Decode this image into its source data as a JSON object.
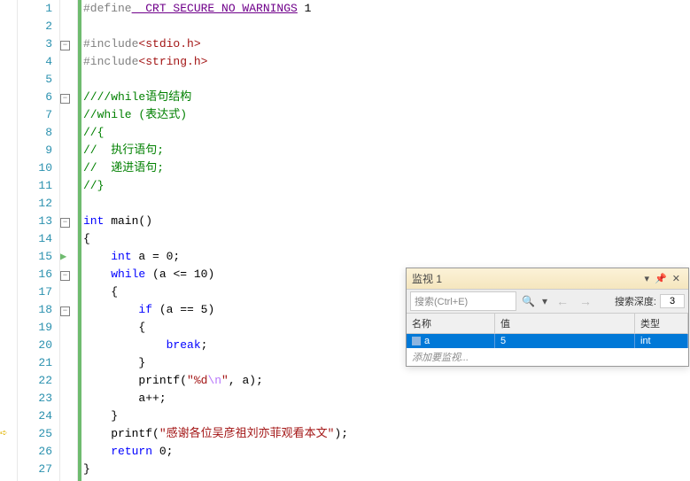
{
  "lines": {
    "1": {
      "n": "1"
    },
    "2": {
      "n": "2"
    },
    "3": {
      "n": "3"
    },
    "4": {
      "n": "4"
    },
    "5": {
      "n": "5"
    },
    "6": {
      "n": "6"
    },
    "7": {
      "n": "7"
    },
    "8": {
      "n": "8"
    },
    "9": {
      "n": "9"
    },
    "10": {
      "n": "10"
    },
    "11": {
      "n": "11"
    },
    "12": {
      "n": "12"
    },
    "13": {
      "n": "13"
    },
    "14": {
      "n": "14"
    },
    "15": {
      "n": "15"
    },
    "16": {
      "n": "16"
    },
    "17": {
      "n": "17"
    },
    "18": {
      "n": "18"
    },
    "19": {
      "n": "19"
    },
    "20": {
      "n": "20"
    },
    "21": {
      "n": "21"
    },
    "22": {
      "n": "22"
    },
    "23": {
      "n": "23"
    },
    "24": {
      "n": "24"
    },
    "25": {
      "n": "25"
    },
    "26": {
      "n": "26"
    },
    "27": {
      "n": "27"
    }
  },
  "code": {
    "l1_define": "#define",
    "l1_macro": " _CRT_SECURE_NO_WARNINGS",
    "l1_val": " 1",
    "l3_inc": "#include",
    "l3_hdr": "<stdio.h>",
    "l4_inc": "#include",
    "l4_hdr": "<string.h>",
    "l6": "////while语句结构",
    "l7": "//while (表达式)",
    "l8": "//{",
    "l9": "//  执行语句;",
    "l10": "//  递进语句;",
    "l11": "//}",
    "l13_int": "int",
    "l13_main": " main()",
    "l14": "{",
    "l15_int": "int",
    "l15_rest": " a = 0;",
    "l16_while": "while",
    "l16_rest": " (a <= 10)",
    "l17": "    {",
    "l18_if": "if",
    "l18_rest": " (a == 5)",
    "l19": "        {",
    "l20_break": "break",
    "l20_semi": ";",
    "l21": "        }",
    "l22_printf": "        printf(",
    "l22_str1": "\"%d",
    "l22_esc": "\\n",
    "l22_str2": "\"",
    "l22_rest": ", a);",
    "l23": "        a++;",
    "l24": "    }",
    "l25_printf": "    printf(",
    "l25_str": "\"感谢各位吴彦祖刘亦菲观看本文\"",
    "l25_end": ");",
    "l26_ret": "return",
    "l26_val": " 0;",
    "l27": "}"
  },
  "watch": {
    "title": "监视 1",
    "search_placeholder": "搜索(Ctrl+E)",
    "depth_label": "搜索深度:",
    "depth_value": "3",
    "hdr_name": "名称",
    "hdr_value": "值",
    "hdr_type": "类型",
    "row_name": "a",
    "row_value": "5",
    "row_type": "int",
    "add_placeholder": "添加要监视..."
  }
}
